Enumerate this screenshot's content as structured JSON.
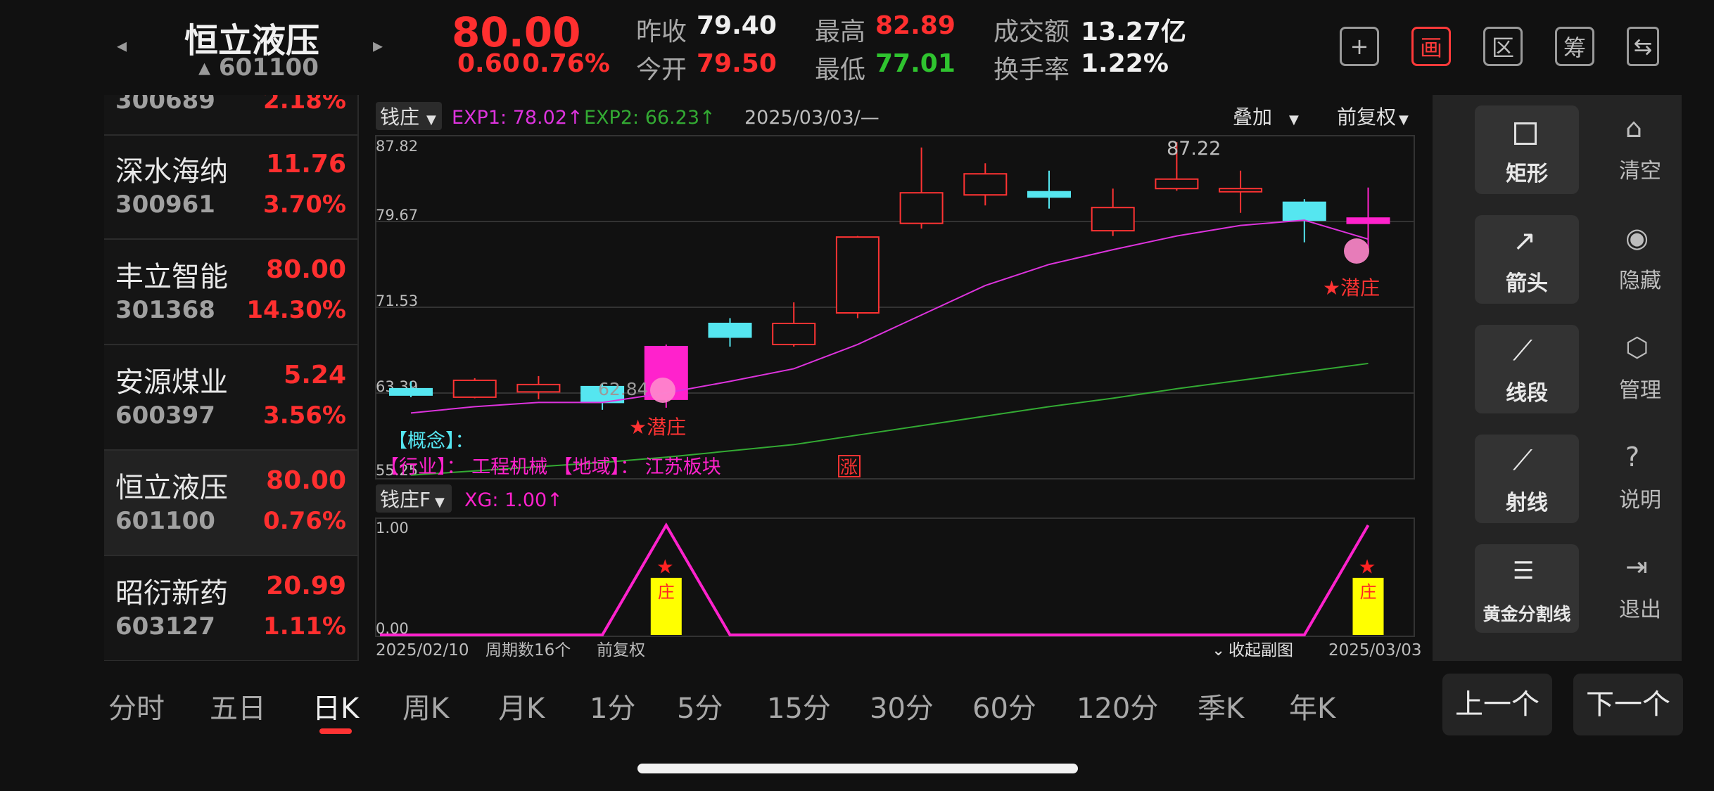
{
  "stock": {
    "name": "恒立液压",
    "code": "601100",
    "price": "80.00",
    "change": "0.60",
    "change_pct": "0.76%",
    "prev_close_label": "昨收",
    "prev_close": "79.40",
    "open_label": "今开",
    "open": "79.50",
    "high_label": "最高",
    "high": "82.89",
    "low_label": "最低",
    "low": "77.01",
    "turnover_label": "成交额",
    "turnover": "13.27亿",
    "turnover_rate_label": "换手率",
    "turnover_rate": "1.22%"
  },
  "header_icons": [
    {
      "name": "add-icon",
      "glyph": "+"
    },
    {
      "name": "draw-icon",
      "glyph": "画"
    },
    {
      "name": "range-icon",
      "glyph": "区"
    },
    {
      "name": "chips-icon",
      "glyph": "筹"
    },
    {
      "name": "switch-device-icon",
      "glyph": "⇆"
    }
  ],
  "watchlist": [
    {
      "name": "",
      "price": "",
      "code": "300689",
      "pct": "2.18%"
    },
    {
      "name": "深水海纳",
      "price": "11.76",
      "code": "300961",
      "pct": "3.70%"
    },
    {
      "name": "丰立智能",
      "price": "80.00",
      "code": "301368",
      "pct": "14.30%"
    },
    {
      "name": "安源煤业",
      "price": "5.24",
      "code": "600397",
      "pct": "3.56%"
    },
    {
      "name": "恒立液压",
      "price": "80.00",
      "code": "601100",
      "pct": "0.76%"
    },
    {
      "name": "昭衍新药",
      "price": "20.99",
      "code": "603127",
      "pct": "1.11%"
    }
  ],
  "main_chart": {
    "indicator_select": "钱庄",
    "exp1_label": "EXP1: 78.02↑",
    "exp2_label": "EXP2: 66.23↑",
    "date_label": "2025/03/03/—",
    "overlay_label": "叠加",
    "adjust_label": "前复权",
    "y_ticks": [
      "87.82",
      "79.67",
      "71.53",
      "63.39",
      "55.25"
    ],
    "max_label": "87.22",
    "min_label": "62.84",
    "marker_label": "★潜庄",
    "concept_label": "【概念】：",
    "industry_label": "【行业】：  工程机械  【地域】：  江苏板块",
    "limit_badge": "涨",
    "colors": {
      "up": "#ff3333",
      "down": "#55e6f0",
      "exp1": "#dd33dd",
      "exp2": "#33aa33",
      "pink": "#ff22cc"
    }
  },
  "chart_data": {
    "type": "candlestick",
    "ylim": [
      55.25,
      87.82
    ],
    "candles": [
      {
        "o": 63.8,
        "h": 64.5,
        "l": 63.0,
        "c": 63.2
      },
      {
        "o": 63.0,
        "h": 64.8,
        "l": 62.9,
        "c": 64.6
      },
      {
        "o": 63.5,
        "h": 65.0,
        "l": 62.8,
        "c": 64.2
      },
      {
        "o": 64.0,
        "h": 64.3,
        "l": 61.8,
        "c": 62.5
      },
      {
        "o": 62.8,
        "h": 68.0,
        "l": 62.0,
        "c": 67.8
      },
      {
        "o": 70.0,
        "h": 70.5,
        "l": 67.8,
        "c": 68.7
      },
      {
        "o": 68.0,
        "h": 72.0,
        "l": 67.8,
        "c": 70.0
      },
      {
        "o": 71.0,
        "h": 78.3,
        "l": 70.5,
        "c": 78.2
      },
      {
        "o": 79.5,
        "h": 86.7,
        "l": 79.0,
        "c": 82.4
      },
      {
        "o": 82.2,
        "h": 85.2,
        "l": 81.2,
        "c": 84.2
      },
      {
        "o": 82.5,
        "h": 84.5,
        "l": 80.9,
        "c": 82.0
      },
      {
        "o": 78.8,
        "h": 82.8,
        "l": 78.3,
        "c": 81.0
      },
      {
        "o": 82.8,
        "h": 87.2,
        "l": 82.6,
        "c": 83.7
      },
      {
        "o": 82.5,
        "h": 84.5,
        "l": 80.5,
        "c": 82.8
      },
      {
        "o": 81.5,
        "h": 81.8,
        "l": 77.7,
        "c": 79.8
      },
      {
        "o": 79.5,
        "h": 82.9,
        "l": 77.0,
        "c": 80.0
      }
    ],
    "exp1": [
      61.5,
      62.1,
      62.5,
      62.5,
      63.4,
      64.5,
      65.7,
      68.0,
      70.8,
      73.6,
      75.6,
      77.0,
      78.3,
      79.3,
      79.8,
      78.0
    ],
    "exp2": [
      55.6,
      56.0,
      56.4,
      56.8,
      57.3,
      57.9,
      58.5,
      59.4,
      60.3,
      61.2,
      62.1,
      62.9,
      63.8,
      64.6,
      65.4,
      66.2
    ]
  },
  "sub_chart": {
    "indicator_select": "钱庄F",
    "xg_label": "XG: 1.00↑",
    "y_ticks": [
      "1.00",
      "0.00"
    ],
    "xg_values": [
      0,
      0,
      0,
      0,
      1,
      0,
      0,
      0,
      0,
      0,
      0,
      0,
      0,
      0,
      0,
      1
    ],
    "star_label": "★",
    "star_sub": "庄",
    "start_date": "2025/02/10",
    "period_count": "周期数16个",
    "adjust": "前复权",
    "collapse": "收起副图",
    "end_date": "2025/03/03"
  },
  "tools": {
    "main": [
      "矩形",
      "箭头",
      "线段",
      "射线",
      "黄金分割线"
    ],
    "side": [
      "清空",
      "隐藏",
      "管理",
      "说明",
      "退出"
    ]
  },
  "tabs": [
    "分时",
    "五日",
    "日K",
    "周K",
    "月K",
    "1分",
    "5分",
    "15分",
    "30分",
    "60分",
    "120分",
    "季K",
    "年K"
  ],
  "active_tab": "日K",
  "nav": {
    "prev": "上一个",
    "next": "下一个"
  }
}
